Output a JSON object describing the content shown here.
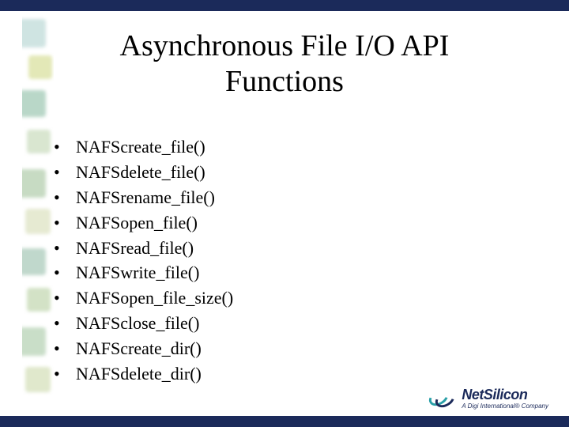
{
  "title_line1": "Asynchronous File I/O API",
  "title_line2": "Functions",
  "functions": [
    "NAFScreate_file()",
    "NAFSdelete_file()",
    "NAFSrename_file()",
    "NAFSopen_file()",
    "NAFSread_file()",
    "NAFSwrite_file()",
    "NAFSopen_file_size()",
    "NAFSclose_file()",
    "NAFScreate_dir()",
    "NAFSdelete_dir()"
  ],
  "logo": {
    "brand_prefix": "Net",
    "brand_suffix": "Silicon",
    "tagline": "A Digi International® Company"
  }
}
